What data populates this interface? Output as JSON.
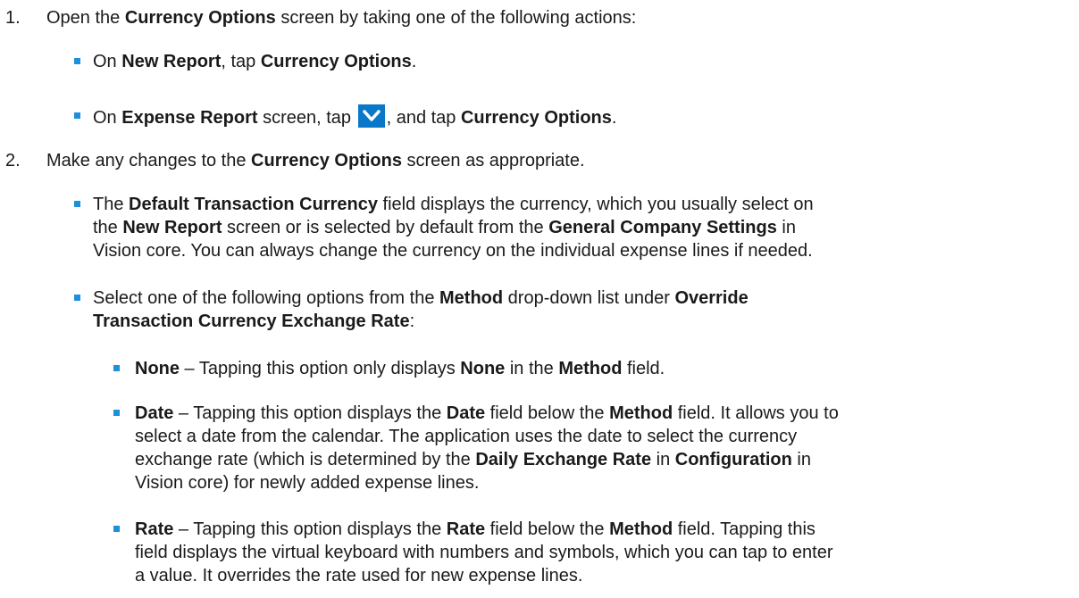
{
  "step1": {
    "number": "1.",
    "pre": "Open the ",
    "bold": "Currency Options",
    "post": " screen by taking one of the following actions:",
    "bullets": {
      "b1": {
        "t1": "On ",
        "b1": "New Report",
        "t2": ", tap ",
        "b2": "Currency Options",
        "t3": "."
      },
      "b2": {
        "t1": "On ",
        "b1": "Expense Report",
        "t2": " screen, tap ",
        "t3": ", and tap ",
        "b2": "Currency Options",
        "t4": ".",
        "icon": "chevron-down-icon",
        "icon_color": "#0a78c8"
      }
    }
  },
  "step2": {
    "number": "2.",
    "pre": "Make any changes to the ",
    "bold": "Currency Options",
    "post": " screen as appropriate.",
    "default_currency": {
      "l1_a": "The ",
      "l1_b": "Default Transaction Currency",
      "l1_c": " field displays the currency, which you usually select on",
      "l2_a": "the ",
      "l2_b": "New Report",
      "l2_c": " screen or is selected by default from the ",
      "l2_d": "General Company Settings",
      "l2_e": " in",
      "l3": "Vision core. You can always change the currency on the individual expense lines if needed."
    },
    "select_method": {
      "l1_a": "Select one of the following options from the ",
      "l1_b": "Method",
      "l1_c": " drop-down list under ",
      "l1_d": "Override",
      "l2_a": "Transaction Currency Exchange Rate",
      "l2_b": ":"
    },
    "options": {
      "none": {
        "name": "None",
        "t1": " – Tapping this option only displays ",
        "b1": "None",
        "t2": " in the ",
        "b2": "Method",
        "t3": " field."
      },
      "date": {
        "name": "Date",
        "l1_a": " – Tapping this option displays the ",
        "l1_b": "Date",
        "l1_c": " field below the ",
        "l1_d": "Method",
        "l1_e": " field. It allows you to",
        "l2": "select a date from the calendar. The application uses the date to select the currency",
        "l3_a": "exchange rate (which is determined by the ",
        "l3_b": "Daily Exchange Rate",
        "l3_c": " in ",
        "l3_d": "Configuration",
        "l3_e": " in",
        "l4": "Vision core) for newly added expense lines."
      },
      "rate": {
        "name": "Rate",
        "l1_a": " – Tapping this option displays the ",
        "l1_b": "Rate",
        "l1_c": " field below the ",
        "l1_d": "Method",
        "l1_e": " field. Tapping this",
        "l2": "field displays the virtual keyboard with numbers and symbols, which you can tap to enter",
        "l3": "a value. It overrides the rate used for new expense lines."
      }
    }
  }
}
